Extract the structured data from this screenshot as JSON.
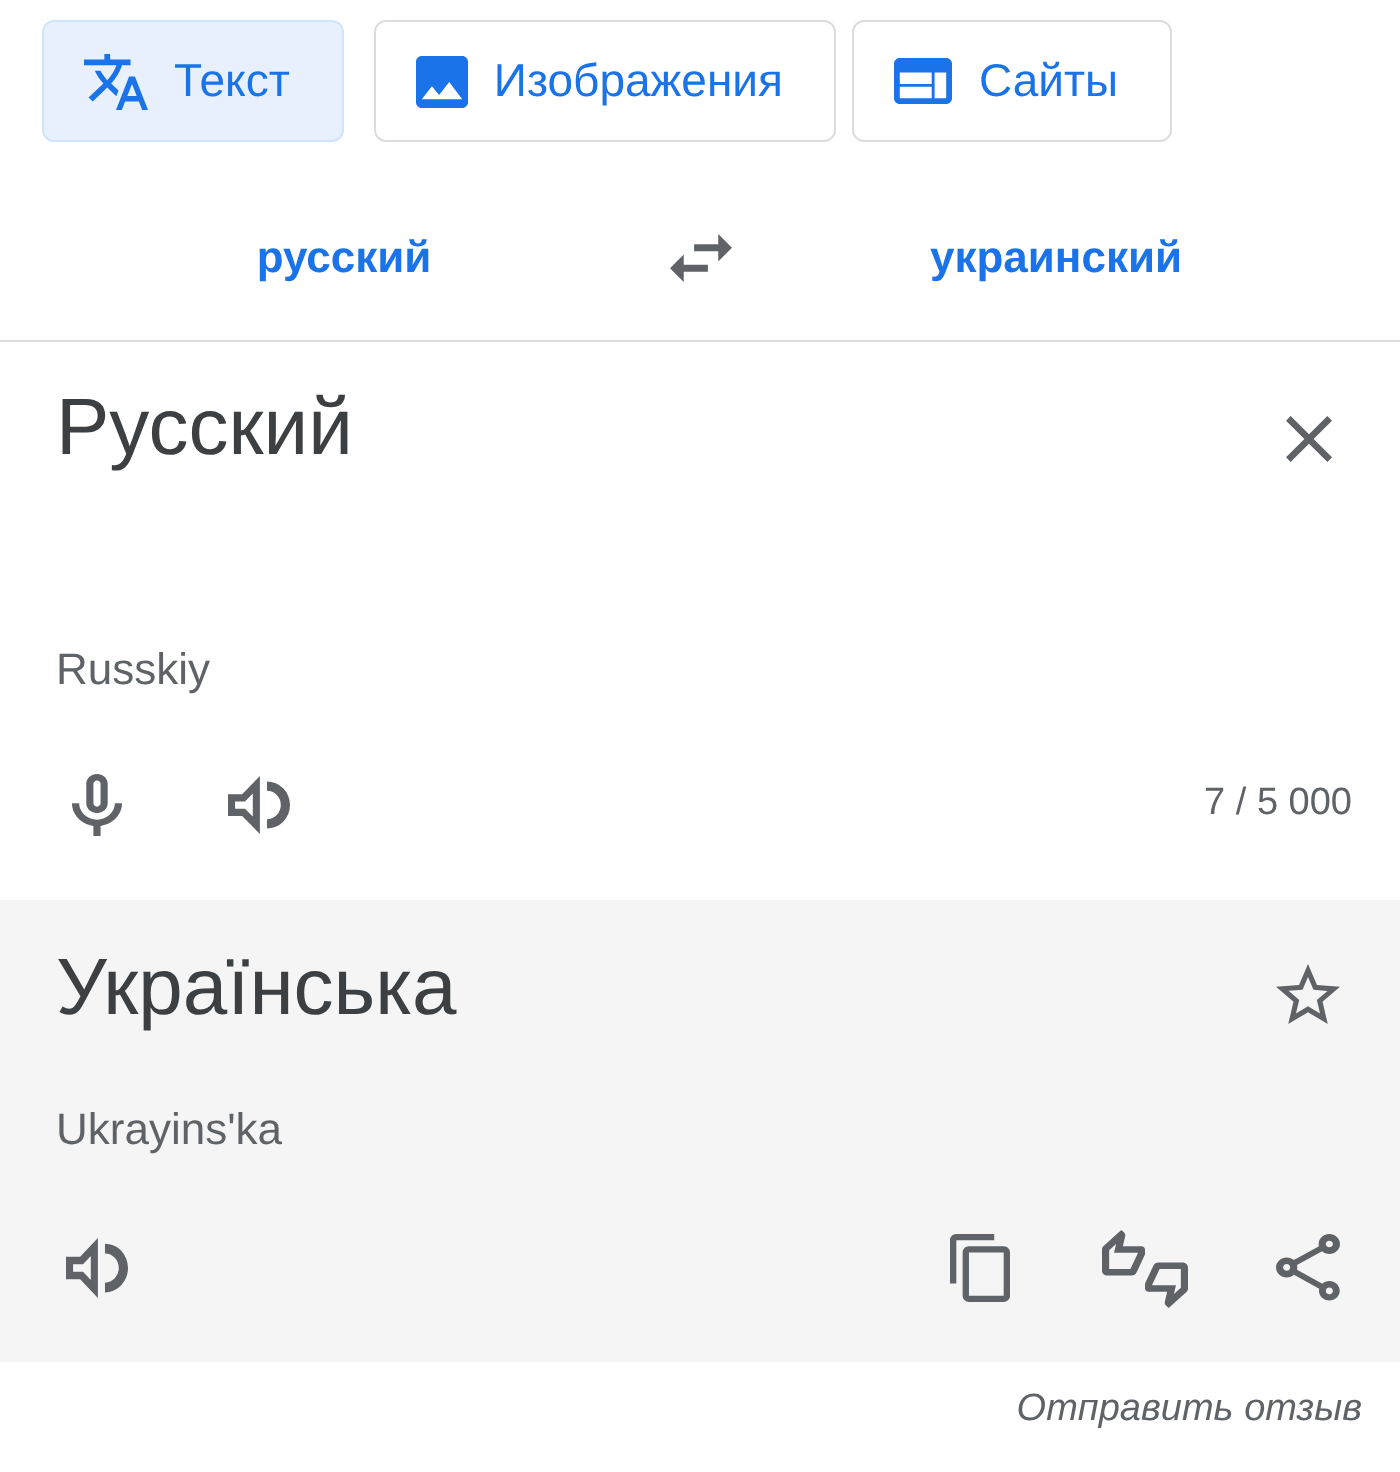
{
  "mode_tabs": [
    {
      "label": "Текст",
      "kind": "text",
      "selected": true
    },
    {
      "label": "Изображения",
      "kind": "images",
      "selected": false
    },
    {
      "label": "Сайты",
      "kind": "sites",
      "selected": false
    }
  ],
  "language_bar": {
    "source_language": "русский",
    "target_language": "украинский"
  },
  "source": {
    "value": "Русский",
    "transliteration": "Russkiy",
    "char_count": "7 / 5 000"
  },
  "translation": {
    "text": "Українська",
    "transliteration": "Ukrayinsʹka",
    "starred": false
  },
  "feedback_link": "Отправить отзыв"
}
